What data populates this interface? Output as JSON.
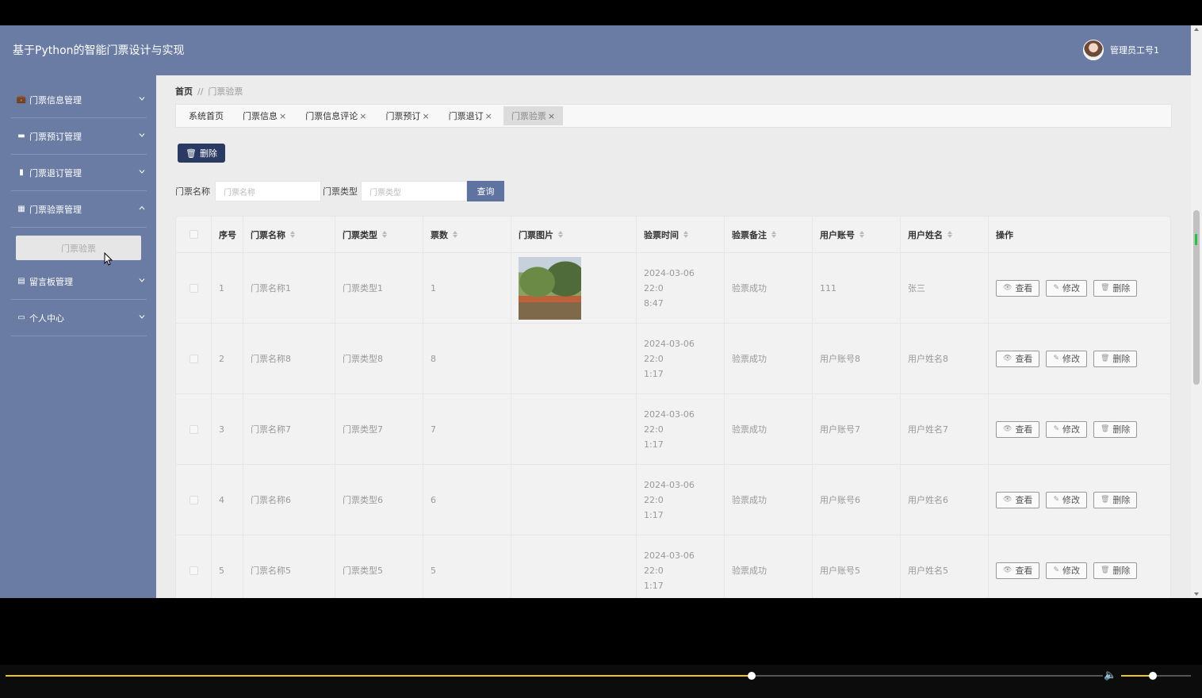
{
  "app": {
    "title": "基于Python的智能门票设计与实现",
    "user_name": "管理员工号1"
  },
  "sidebar": {
    "items": [
      {
        "label": "门票信息管理",
        "icon": "briefcase-icon",
        "expanded": false
      },
      {
        "label": "门票预订管理",
        "icon": "comment-icon",
        "expanded": false
      },
      {
        "label": "门票退订管理",
        "icon": "bar-chart-icon",
        "expanded": false
      },
      {
        "label": "门票验票管理",
        "icon": "grid-icon",
        "expanded": true
      },
      {
        "label": "留言板管理",
        "icon": "clipboard-icon",
        "expanded": false
      },
      {
        "label": "个人中心",
        "icon": "calendar-icon",
        "expanded": false
      }
    ],
    "subitem": "门票验票"
  },
  "breadcrumb": {
    "home": "首页",
    "separator": "//",
    "current": "门票验票"
  },
  "tabs": [
    {
      "label": "系统首页"
    },
    {
      "label": "门票信息"
    },
    {
      "label": "门票信息评论"
    },
    {
      "label": "门票预订"
    },
    {
      "label": "门票退订"
    },
    {
      "label": "门票验票"
    }
  ],
  "tab_close_glyph": "×",
  "toolbar": {
    "delete_label": "删除"
  },
  "search": {
    "name_label": "门票名称",
    "name_placeholder": "门票名称",
    "type_label": "门票类型",
    "type_placeholder": "门票类型",
    "query_label": "查询"
  },
  "table": {
    "headers": [
      "序号",
      "门票名称",
      "门票类型",
      "票数",
      "门票图片",
      "验票时间",
      "验票备注",
      "用户账号",
      "用户姓名",
      "操作"
    ],
    "rows": [
      {
        "idx": "1",
        "name": "门票名称1",
        "type": "门票类型1",
        "count": "1",
        "has_image": true,
        "time": "2024-03-06 22:08:47",
        "time_l1": "2024-03-06 22:0",
        "time_l2": "8:47",
        "note": "验票成功",
        "account": "111",
        "username": "张三"
      },
      {
        "idx": "2",
        "name": "门票名称8",
        "type": "门票类型8",
        "count": "8",
        "has_image": false,
        "time": "2024-03-06 22:01:17",
        "time_l1": "2024-03-06 22:0",
        "time_l2": "1:17",
        "note": "验票成功",
        "account": "用户账号8",
        "username": "用户姓名8"
      },
      {
        "idx": "3",
        "name": "门票名称7",
        "type": "门票类型7",
        "count": "7",
        "has_image": false,
        "time": "2024-03-06 22:01:17",
        "time_l1": "2024-03-06 22:0",
        "time_l2": "1:17",
        "note": "验票成功",
        "account": "用户账号7",
        "username": "用户姓名7"
      },
      {
        "idx": "4",
        "name": "门票名称6",
        "type": "门票类型6",
        "count": "6",
        "has_image": false,
        "time": "2024-03-06 22:01:17",
        "time_l1": "2024-03-06 22:0",
        "time_l2": "1:17",
        "note": "验票成功",
        "account": "用户账号6",
        "username": "用户姓名6"
      },
      {
        "idx": "5",
        "name": "门票名称5",
        "type": "门票类型5",
        "count": "5",
        "has_image": false,
        "time": "2024-03-06 22:01:17",
        "time_l1": "2024-03-06 22:0",
        "time_l2": "1:17",
        "note": "验票成功",
        "account": "用户账号5",
        "username": "用户姓名5"
      }
    ],
    "actions": {
      "view": "查看",
      "edit": "修改",
      "delete": "删除"
    }
  },
  "player": {
    "progress_fraction": 0.68,
    "volume_fraction": 0.45
  },
  "colors": {
    "topbar": "#6a7ca3",
    "sidebar": "#6a7ca3",
    "primary_dark": "#2a3a63",
    "query_btn": "#5f73a0",
    "progress": "#f0c419"
  }
}
